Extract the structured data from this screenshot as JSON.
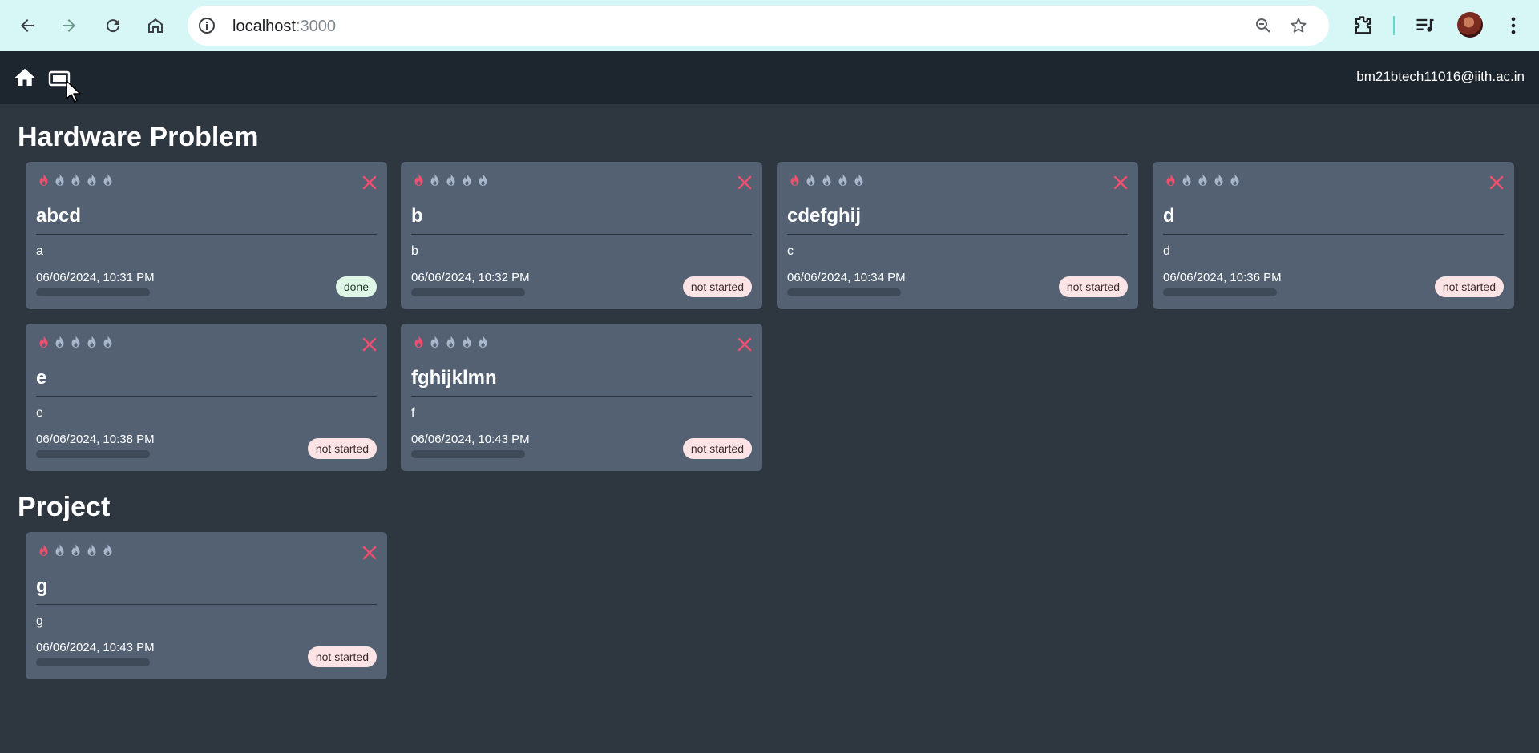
{
  "browser": {
    "url_host": "localhost",
    "url_port": ":3000"
  },
  "navbar": {
    "email": "bm21btech11016@iith.ac.in"
  },
  "colors": {
    "flame_active": "#f0506e",
    "flame_inactive": "#a9b8cc",
    "close": "#f0506e",
    "badge_not_started": "#fce4e6",
    "badge_done": "#dff7e6"
  },
  "sections": [
    {
      "title": "Hardware Problem",
      "cards": [
        {
          "title": "abcd",
          "description": "a",
          "date": "06/06/2024, 10:31 PM",
          "status": "done",
          "priority": 1
        },
        {
          "title": "b",
          "description": "b",
          "date": "06/06/2024, 10:32 PM",
          "status": "not started",
          "priority": 1
        },
        {
          "title": "cdefghij",
          "description": "c",
          "date": "06/06/2024, 10:34 PM",
          "status": "not started",
          "priority": 1
        },
        {
          "title": "d",
          "description": "d",
          "date": "06/06/2024, 10:36 PM",
          "status": "not started",
          "priority": 1
        },
        {
          "title": "e",
          "description": "e",
          "date": "06/06/2024, 10:38 PM",
          "status": "not started",
          "priority": 1
        },
        {
          "title": "fghijklmn",
          "description": "f",
          "date": "06/06/2024, 10:43 PM",
          "status": "not started",
          "priority": 1
        }
      ]
    },
    {
      "title": "Project",
      "cards": [
        {
          "title": "g",
          "description": "g",
          "date": "06/06/2024, 10:43 PM",
          "status": "not started",
          "priority": 1
        }
      ]
    }
  ]
}
